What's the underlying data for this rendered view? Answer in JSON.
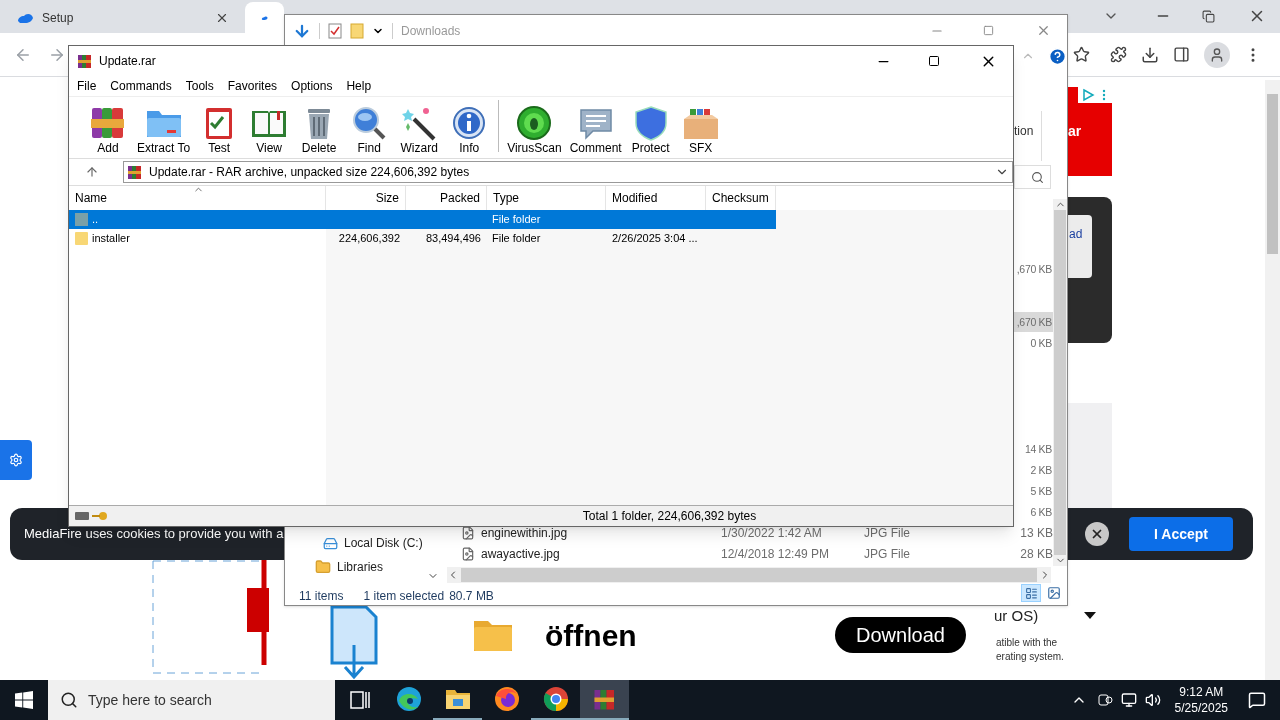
{
  "browser": {
    "tabs": [
      {
        "title": "Setup",
        "selected": false
      },
      {
        "selected": true
      }
    ]
  },
  "page": {
    "ad_text": "ar",
    "card_link": "ad",
    "os_select": "ur OS)",
    "note": "atible with the erating system.",
    "open_label": "öffnen",
    "download_button": "Download",
    "cookie_banner": {
      "text": "MediaFire uses cookies to provide you with a",
      "accept_button": "I Accept"
    }
  },
  "explorer": {
    "title": "Downloads",
    "ribbon_text": "tion",
    "size_rows": [
      {
        "size": ",670 KB",
        "selected": false
      },
      {
        "size": ",670 KB",
        "selected": true
      },
      {
        "size": "0 KB",
        "selected": false
      },
      {
        "size": "14 KB",
        "selected": false
      },
      {
        "size": "2 KB",
        "selected": false
      },
      {
        "size": "5 KB",
        "selected": false
      },
      {
        "size": "6 KB",
        "selected": false
      }
    ],
    "files": [
      {
        "name": "enginewithin.jpg",
        "modified": "1/30/2022 1:42 AM",
        "type": "JPG File",
        "size": "13 KB"
      },
      {
        "name": "awayactive.jpg",
        "modified": "12/4/2018 12:49 PM",
        "type": "JPG File",
        "size": "28 KB"
      }
    ],
    "nav": [
      {
        "label": "Local Disk (C:)",
        "kind": "drive"
      },
      {
        "label": "Libraries",
        "kind": "library"
      }
    ],
    "status": [
      "11 items",
      "1 item selected",
      "80.7 MB"
    ]
  },
  "winrar": {
    "title": "Update.rar",
    "menu": [
      "File",
      "Commands",
      "Tools",
      "Favorites",
      "Options",
      "Help"
    ],
    "toolbar": [
      "Add",
      "Extract To",
      "Test",
      "View",
      "Delete",
      "Find",
      "Wizard",
      "Info",
      "VirusScan",
      "Comment",
      "Protect",
      "SFX"
    ],
    "address": "Update.rar - RAR archive, unpacked size 224,606,392 bytes",
    "columns": [
      "Name",
      "Size",
      "Packed",
      "Type",
      "Modified",
      "Checksum"
    ],
    "rows": [
      {
        "name": "..",
        "size": "",
        "packed": "",
        "type": "File folder",
        "modified": "",
        "selected": true,
        "kind": "parent"
      },
      {
        "name": "installer",
        "size": "224,606,392",
        "packed": "83,494,496",
        "type": "File folder",
        "modified": "2/26/2025 3:04 ...",
        "selected": false,
        "kind": "folder"
      }
    ],
    "status": "Total 1 folder, 224,606,392 bytes"
  },
  "taskbar": {
    "search_placeholder": "Type here to search",
    "apps": [
      {
        "selected": false
      },
      {
        "selected": false
      },
      {
        "selected": false
      },
      {
        "selected": false
      },
      {
        "selected": true
      }
    ],
    "time": "9:12 AM",
    "date": "5/25/2025"
  }
}
